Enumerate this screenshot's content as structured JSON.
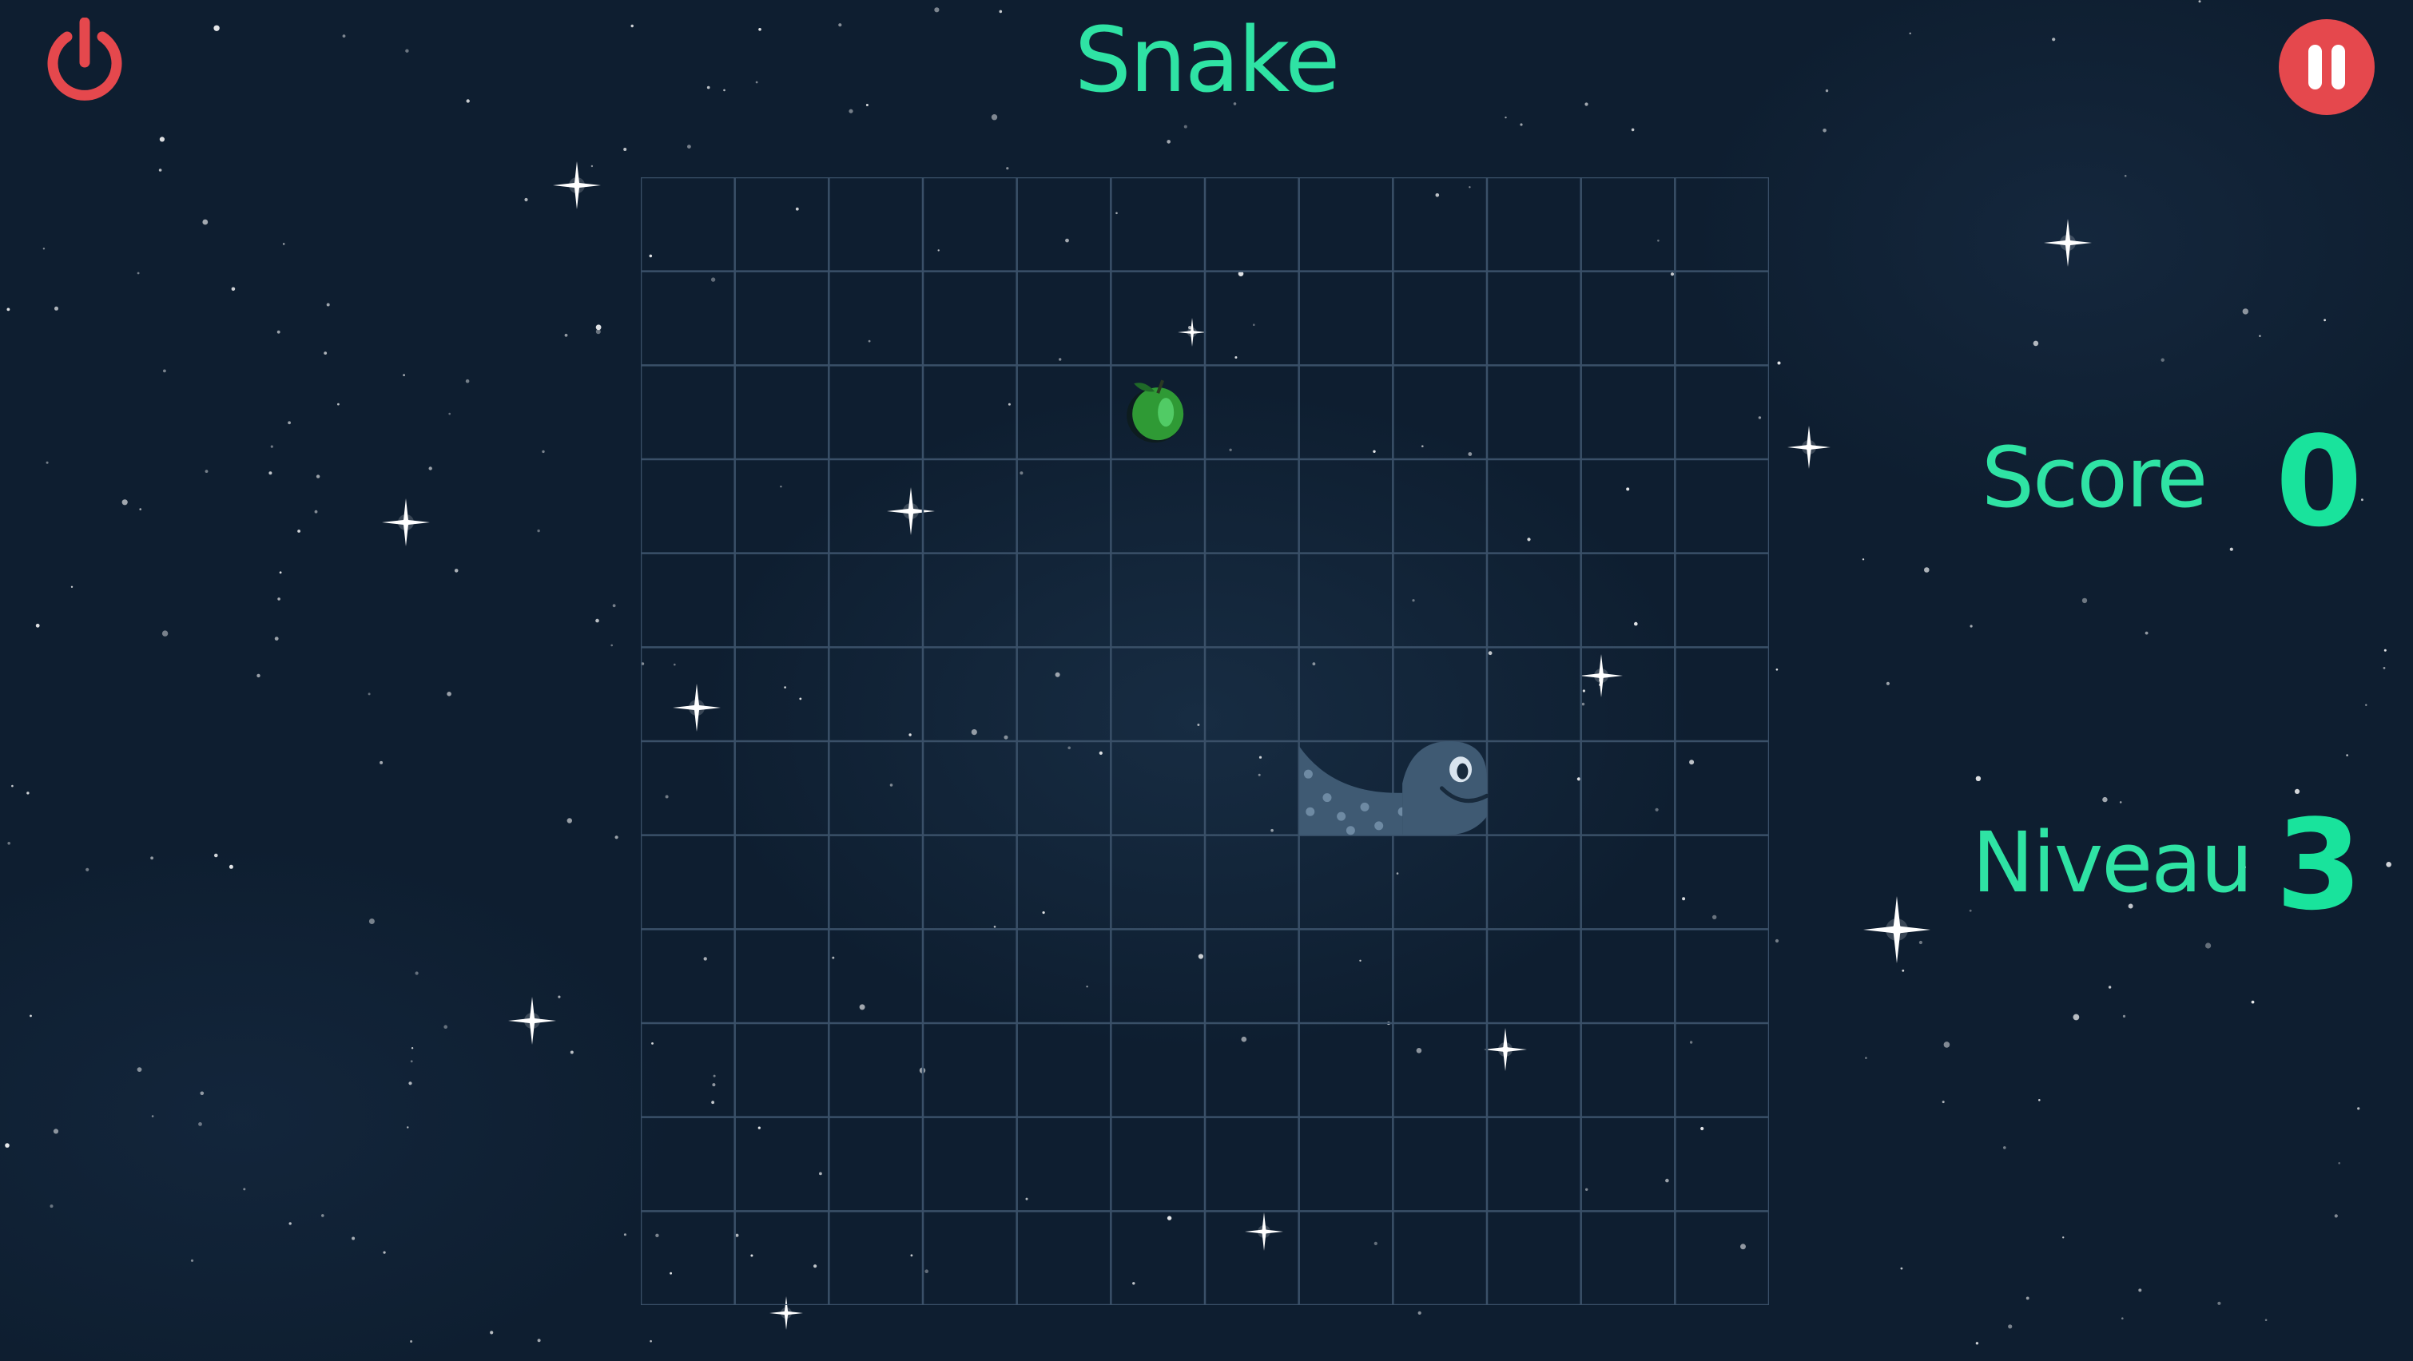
{
  "title": "Snake",
  "controls": {
    "power_icon": "power-icon",
    "pause_icon": "pause-icon"
  },
  "stats": {
    "score_label": "Score",
    "score_value": "0",
    "level_label": "Niveau",
    "level_value": "3"
  },
  "board": {
    "columns": 12,
    "rows": 12,
    "apple": {
      "col": 5,
      "row": 2
    },
    "snake": [
      {
        "col": 7,
        "row": 6,
        "part": "tail"
      },
      {
        "col": 8,
        "row": 6,
        "part": "head"
      }
    ]
  },
  "colors": {
    "background": "#0e1e30",
    "accent": "#2fe3a4",
    "button": "#e5484d",
    "grid_line": "#3a5068",
    "snake": "#3f5a73",
    "apple": "#2f9a35"
  }
}
